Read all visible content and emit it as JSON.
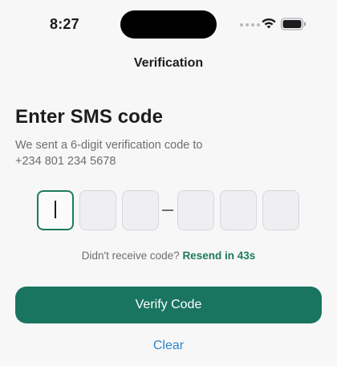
{
  "status_bar": {
    "time": "8:27",
    "icons": [
      "signal-icon",
      "wifi-icon",
      "battery-icon"
    ]
  },
  "nav": {
    "title": "Verification"
  },
  "main": {
    "heading": "Enter SMS code",
    "subtitle_line1": "We sent a 6-digit verification code to",
    "subtitle_line2": "+234 801 234 5678",
    "code_digits": [
      "",
      "",
      "",
      "",
      "",
      ""
    ],
    "separator": "–",
    "resend_prompt": "Didn't receive code?",
    "resend_link": "Resend in 43s",
    "verify_label": "Verify Code",
    "clear_label": "Clear"
  },
  "colors": {
    "accent": "#1a7560",
    "link": "#2f86c9",
    "background": "#f7f7f8"
  }
}
